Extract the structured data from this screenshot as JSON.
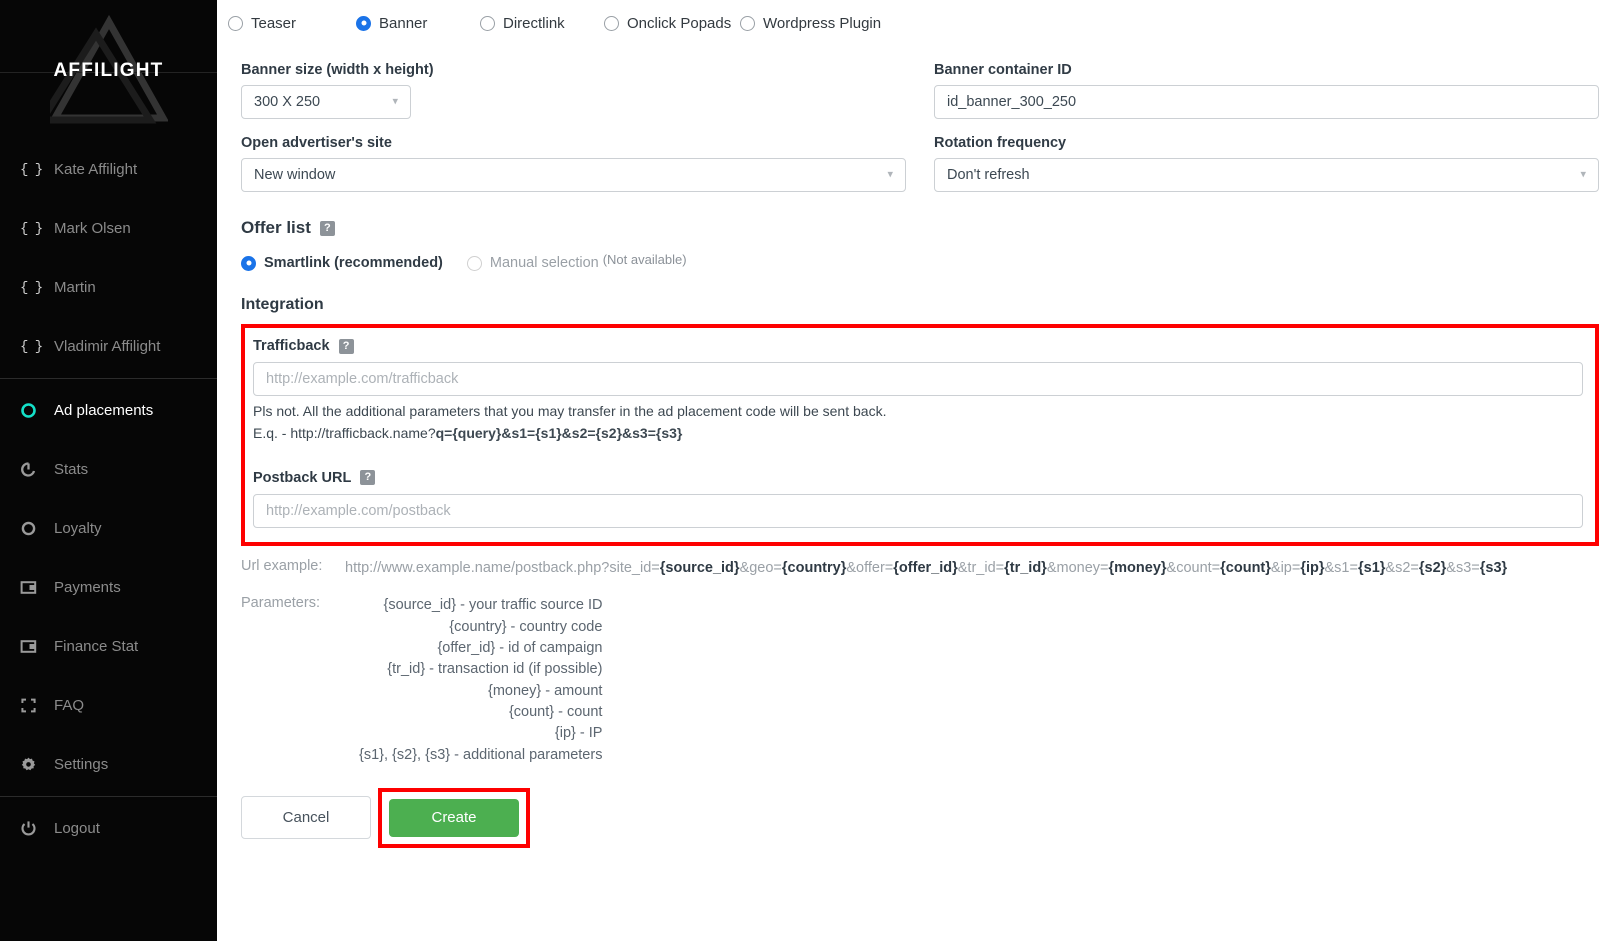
{
  "sidebar": {
    "logo_text": "AFFILIGHT",
    "users": [
      {
        "label": "Kate Affilight",
        "icon": "braces-icon"
      },
      {
        "label": "Mark Olsen",
        "icon": "braces-icon"
      },
      {
        "label": "Martin",
        "icon": "braces-icon"
      },
      {
        "label": "Vladimir Affilight",
        "icon": "braces-icon"
      }
    ],
    "nav": [
      {
        "label": "Ad placements",
        "icon": "circle-icon",
        "active": true
      },
      {
        "label": "Stats",
        "icon": "pie-chart-icon",
        "active": false
      },
      {
        "label": "Loyalty",
        "icon": "circle-icon",
        "active": false
      },
      {
        "label": "Payments",
        "icon": "wallet-icon",
        "active": false
      },
      {
        "label": "Finance Stat",
        "icon": "wallet-icon",
        "active": false
      },
      {
        "label": "FAQ",
        "icon": "brackets-icon",
        "active": false
      },
      {
        "label": "Settings",
        "icon": "gear-icon",
        "active": false
      }
    ],
    "logout": {
      "label": "Logout",
      "icon": "power-icon"
    },
    "accent_color": "#14e0c8"
  },
  "ad_type_radios": {
    "options": [
      {
        "label": "Teaser",
        "selected": false
      },
      {
        "label": "Banner",
        "selected": true
      },
      {
        "label": "Directlink",
        "selected": false
      },
      {
        "label": "Onclick Popads",
        "selected": false
      },
      {
        "label": "Wordpress Plugin",
        "selected": false
      }
    ],
    "selected_color": "#1a73e8"
  },
  "form": {
    "banner_size": {
      "label": "Banner size (width x height)",
      "value": "300 X 250"
    },
    "banner_container_id": {
      "label": "Banner container ID",
      "value": "id_banner_300_250",
      "placeholder": ""
    },
    "open_site": {
      "label": "Open advertiser's site",
      "value": "New window"
    },
    "rotation_frequency": {
      "label": "Rotation frequency",
      "value": "Don't refresh"
    }
  },
  "offer_list": {
    "title": "Offer list",
    "help": "?",
    "options": [
      {
        "label": "Smartlink (recommended)",
        "selected": true,
        "disabled": false
      },
      {
        "label": "Manual selection",
        "selected": false,
        "disabled": true
      }
    ],
    "not_available": "(Not available)"
  },
  "integration": {
    "title": "Integration",
    "highlight_color": "#fe0000",
    "trafficback": {
      "label": "Trafficback",
      "help": "?",
      "placeholder": "http://example.com/trafficback",
      "value": "",
      "note_line1": "Pls not. All the additional parameters that you may transfer in the ad placement code will be sent back.",
      "note_line2_plain": "E.q. - http://trafficback.name?",
      "note_line2_bold": "q={query}&s1={s1}&s2={s2}&s3={s3}"
    },
    "postback": {
      "label": "Postback URL",
      "help": "?",
      "placeholder": "http://example.com/postback",
      "value": ""
    }
  },
  "url_example": {
    "label": "Url example:",
    "segments": [
      {
        "t": "http://www.example.name/postback.php?site_id=",
        "b": false
      },
      {
        "t": "{source_id}",
        "b": true
      },
      {
        "t": "&geo=",
        "b": false
      },
      {
        "t": "{country}",
        "b": true
      },
      {
        "t": "&offer=",
        "b": false
      },
      {
        "t": "{offer_id}",
        "b": true
      },
      {
        "t": "&tr_id=",
        "b": false
      },
      {
        "t": "{tr_id}",
        "b": true
      },
      {
        "t": "&money=",
        "b": false
      },
      {
        "t": "{money}",
        "b": true
      },
      {
        "t": "&count=",
        "b": false
      },
      {
        "t": "{count}",
        "b": true
      },
      {
        "t": "&ip=",
        "b": false
      },
      {
        "t": "{ip}",
        "b": true
      },
      {
        "t": "&s1=",
        "b": false
      },
      {
        "t": "{s1}",
        "b": true
      },
      {
        "t": "&s2=",
        "b": false
      },
      {
        "t": "{s2}",
        "b": true
      },
      {
        "t": "&s3=",
        "b": false
      },
      {
        "t": "{s3}",
        "b": true
      }
    ]
  },
  "parameters": {
    "label": "Parameters:",
    "items": [
      "{source_id} - your traffic source ID",
      "{country} - country code",
      "{offer_id} - id of campaign",
      "{tr_id} - transaction id (if possible)",
      "{money} - amount",
      "{count} - count",
      "{ip} - IP",
      "{s1}, {s2}, {s3} - additional parameters"
    ]
  },
  "actions": {
    "cancel_label": "Cancel",
    "create_label": "Create",
    "create_color": "#4caf50"
  }
}
